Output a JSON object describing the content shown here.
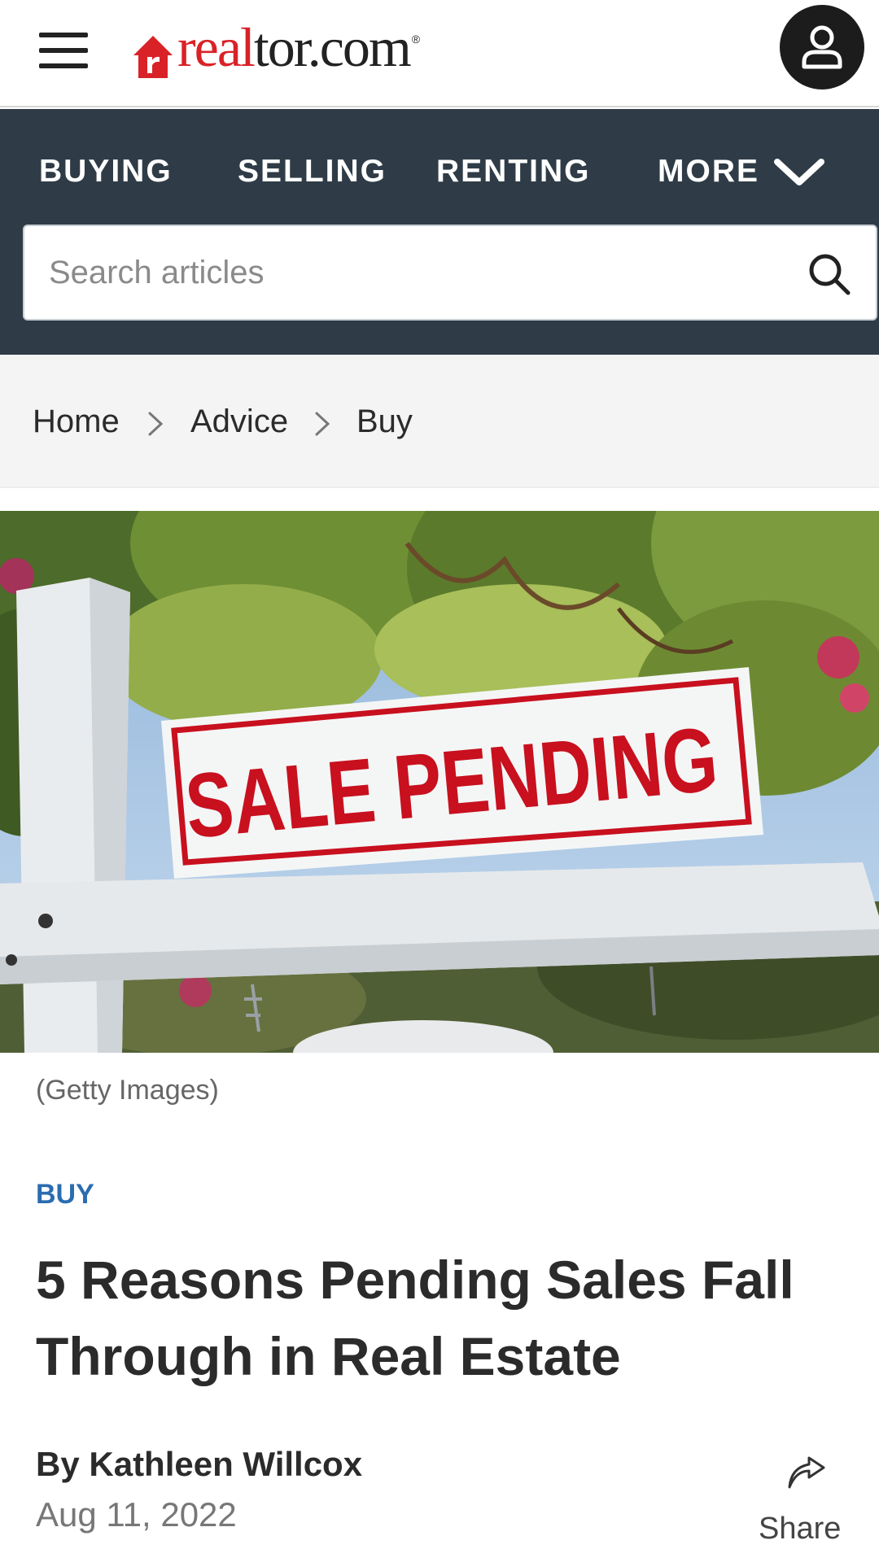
{
  "header": {
    "logo_red": "real",
    "logo_dark": "tor.com",
    "logo_reg": "®",
    "menu_icon": "hamburger-menu-icon",
    "account_icon": "user-account-icon"
  },
  "nav": {
    "items": [
      {
        "label": "BUYING"
      },
      {
        "label": "SELLING"
      },
      {
        "label": "RENTING"
      },
      {
        "label": "MORE"
      }
    ],
    "more_icon": "chevron-down-icon",
    "background": "#2f3c47"
  },
  "search": {
    "placeholder": "Search articles",
    "value": "",
    "icon": "search-icon"
  },
  "breadcrumb": {
    "items": [
      {
        "label": "Home"
      },
      {
        "label": "Advice"
      },
      {
        "label": "Buy"
      }
    ],
    "separator_icon": "chevron-right-icon"
  },
  "hero": {
    "sign_text": "SALE PENDING",
    "caption": "(Getty Images)"
  },
  "article": {
    "category": "BUY",
    "title": "5 Reasons Pending Sales Fall Through in Real Estate",
    "byline_prefix": "By",
    "author": "Kathleen Willcox",
    "date": "Aug 11, 2022",
    "share_label": "Share",
    "share_icon": "share-arrow-icon"
  },
  "colors": {
    "brand_red": "#d92228",
    "category_blue": "#2a6cb0",
    "nav_bg": "#2f3c47"
  }
}
